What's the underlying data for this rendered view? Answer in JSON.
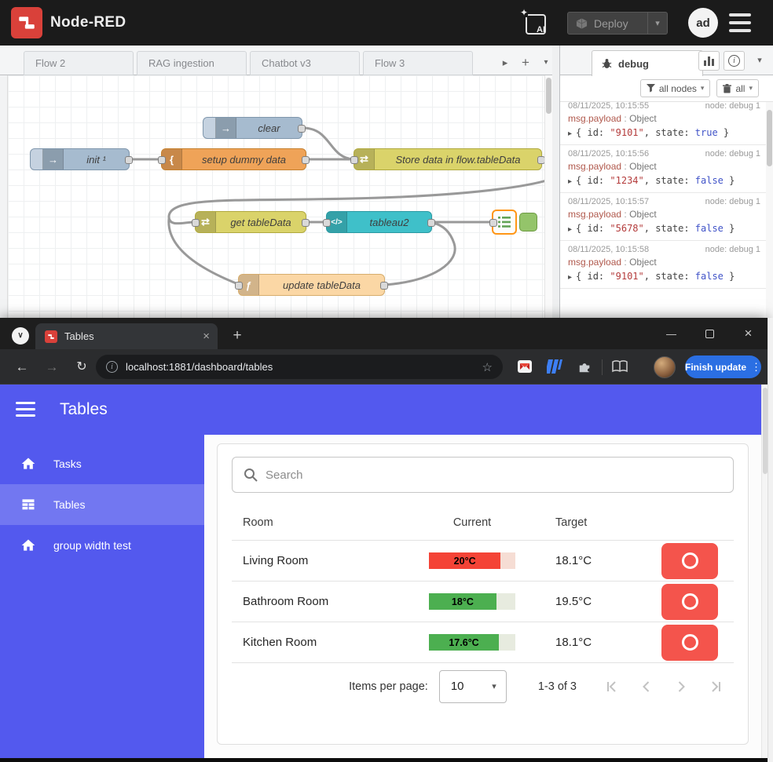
{
  "icons": {
    "caret_down": "▾",
    "tab_scroll": "▸",
    "add": "+",
    "inject_arrow": "→",
    "change_icon": "⇄",
    "brace": "{",
    "template_icon": "</>",
    "function_icon": "ƒ",
    "close": "×",
    "minimize": "—",
    "window_chevron": "∨",
    "back": "←",
    "forward": "→",
    "reload": "↻",
    "star": "☆",
    "kebab": "⋮",
    "sparkle": "✦",
    "expand_caret": "▸",
    "info": "i"
  },
  "node_red": {
    "header": {
      "title": "Node-RED",
      "ai_label": "AI",
      "deploy_label": "Deploy",
      "avatar_text": "ad"
    },
    "tabs": [
      "Flow 2",
      "RAG ingestion",
      "Chatbot v3",
      "Flow 3"
    ],
    "flow": {
      "nodes": [
        {
          "label": "clear"
        },
        {
          "label": "init ¹"
        },
        {
          "label": "setup dummy data"
        },
        {
          "label": "Store data in flow.tableData"
        },
        {
          "label": "get tableData"
        },
        {
          "label": "tableau2"
        },
        {
          "label": "update tableData"
        }
      ]
    },
    "debug": {
      "tab_label": "debug",
      "filter_label": "all nodes",
      "trash_label": "all",
      "payload_path": "msg.payload",
      "payload_sep": " : ",
      "payload_type": "Object",
      "json_open": "{ id: ",
      "json_mid": ", state: ",
      "json_close": " }",
      "messages": [
        {
          "time": "08/11/2025, 10:15:55",
          "node": "node: debug 1",
          "id": "\"9101\"",
          "state": "true"
        },
        {
          "time": "08/11/2025, 10:15:56",
          "node": "node: debug 1",
          "id": "\"1234\"",
          "state": "false"
        },
        {
          "time": "08/11/2025, 10:15:57",
          "node": "node: debug 1",
          "id": "\"5678\"",
          "state": "false"
        },
        {
          "time": "08/11/2025, 10:15:58",
          "node": "node: debug 1",
          "id": "\"9101\"",
          "state": "false"
        }
      ]
    }
  },
  "browser": {
    "tab_title": "Tables",
    "url": "localhost:1881/dashboard/tables",
    "update_button": "Finish update"
  },
  "dashboard": {
    "theme": {
      "primary": "#5359ee",
      "button_red": "#f4544c"
    },
    "title": "Tables",
    "sidebar": [
      {
        "label": "Tasks"
      },
      {
        "label": "Tables"
      },
      {
        "label": "group width test"
      }
    ],
    "search_placeholder": "Search",
    "table": {
      "headers": [
        "Room",
        "Current",
        "Target"
      ],
      "rows": [
        {
          "room": "Living Room",
          "current": "20°C",
          "current_pct": 83,
          "current_color": "#f44336",
          "track_color": "#f6ddd4",
          "target": "18.1°C"
        },
        {
          "room": "Bathroom Room",
          "current": "18°C",
          "current_pct": 78,
          "current_color": "#4caf50",
          "track_color": "#e7ebdf",
          "target": "19.5°C"
        },
        {
          "room": "Kitchen Room",
          "current": "17.6°C",
          "current_pct": 81,
          "current_color": "#4caf50",
          "track_color": "#e7ebdf",
          "target": "18.1°C"
        }
      ]
    },
    "pagination": {
      "items_per_page_label": "Items per page:",
      "page_size": "10",
      "range_label": "1-3 of 3"
    }
  }
}
